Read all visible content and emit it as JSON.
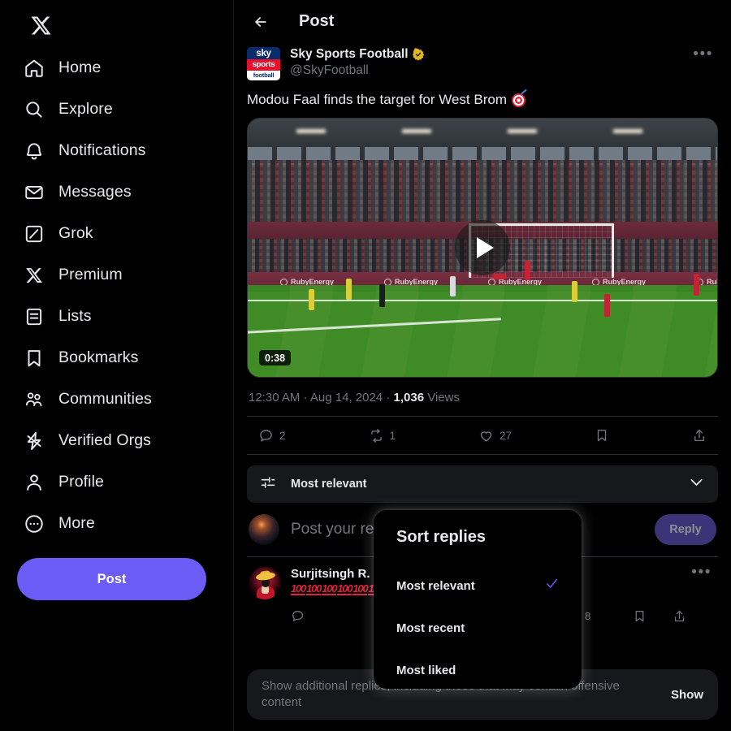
{
  "sidebar": {
    "logo": "X",
    "items": [
      {
        "label": "Home",
        "icon": "home-icon"
      },
      {
        "label": "Explore",
        "icon": "search-icon"
      },
      {
        "label": "Notifications",
        "icon": "bell-icon"
      },
      {
        "label": "Messages",
        "icon": "envelope-icon"
      },
      {
        "label": "Grok",
        "icon": "grok-icon"
      },
      {
        "label": "Premium",
        "icon": "x-icon"
      },
      {
        "label": "Lists",
        "icon": "list-icon"
      },
      {
        "label": "Bookmarks",
        "icon": "bookmark-icon"
      },
      {
        "label": "Communities",
        "icon": "people-icon"
      },
      {
        "label": "Verified Orgs",
        "icon": "bolt-icon"
      },
      {
        "label": "Profile",
        "icon": "person-icon"
      },
      {
        "label": "More",
        "icon": "ellipsis-circle-icon"
      }
    ],
    "post_button": "Post"
  },
  "topbar": {
    "title": "Post",
    "back_icon": "arrow-left-icon"
  },
  "post": {
    "author_name": "Sky Sports Football",
    "author_handle": "@SkyFootball",
    "verified": true,
    "avatar_lines": {
      "line1": "sky",
      "line2": "sports",
      "line3": "football"
    },
    "text": "Modou Faal finds the target for West Brom",
    "text_emoji": "dart-emoji",
    "video": {
      "duration": "0:38",
      "play_icon": "play-icon",
      "board_text": "RubyEnergy"
    },
    "meta": {
      "time": "12:30 AM",
      "sep1": "·",
      "date": "Aug 14, 2024",
      "sep2": "·",
      "views_count": "1,036",
      "views_label": "Views"
    },
    "actions": {
      "reply_count": "2",
      "repost_count": "1",
      "like_count": "27",
      "bookmark_count": "",
      "share_count": ""
    },
    "more_icon": "ellipsis-icon"
  },
  "sort_bar": {
    "label": "Most relevant",
    "filter_icon": "sliders-icon",
    "chevron_icon": "chevron-down-icon"
  },
  "reply_composer": {
    "placeholder": "Post your reply",
    "button_label": "Reply"
  },
  "replies": [
    {
      "name": "Surjitsingh R. .",
      "text_emoji_count": 6,
      "text": "💯💯💯💯💯💯",
      "like_count": "8",
      "more_icon": "ellipsis-icon"
    }
  ],
  "show_bar": {
    "text": "Show additional replies, including those that may contain offensive content",
    "button_label": "Show"
  },
  "dropdown": {
    "title": "Sort replies",
    "items": [
      {
        "label": "Most relevant",
        "checked": true
      },
      {
        "label": "Most recent",
        "checked": false
      },
      {
        "label": "Most liked",
        "checked": false
      }
    ],
    "check_icon": "check-icon"
  },
  "colors": {
    "accent": "#6b5cf6",
    "background": "#000000",
    "panel": "#16181c",
    "text_primary": "#e7e9ea",
    "text_secondary": "#71767b",
    "border": "#2f3336",
    "verified_gold": "#e2b719",
    "heart_red": "#e0243d"
  }
}
